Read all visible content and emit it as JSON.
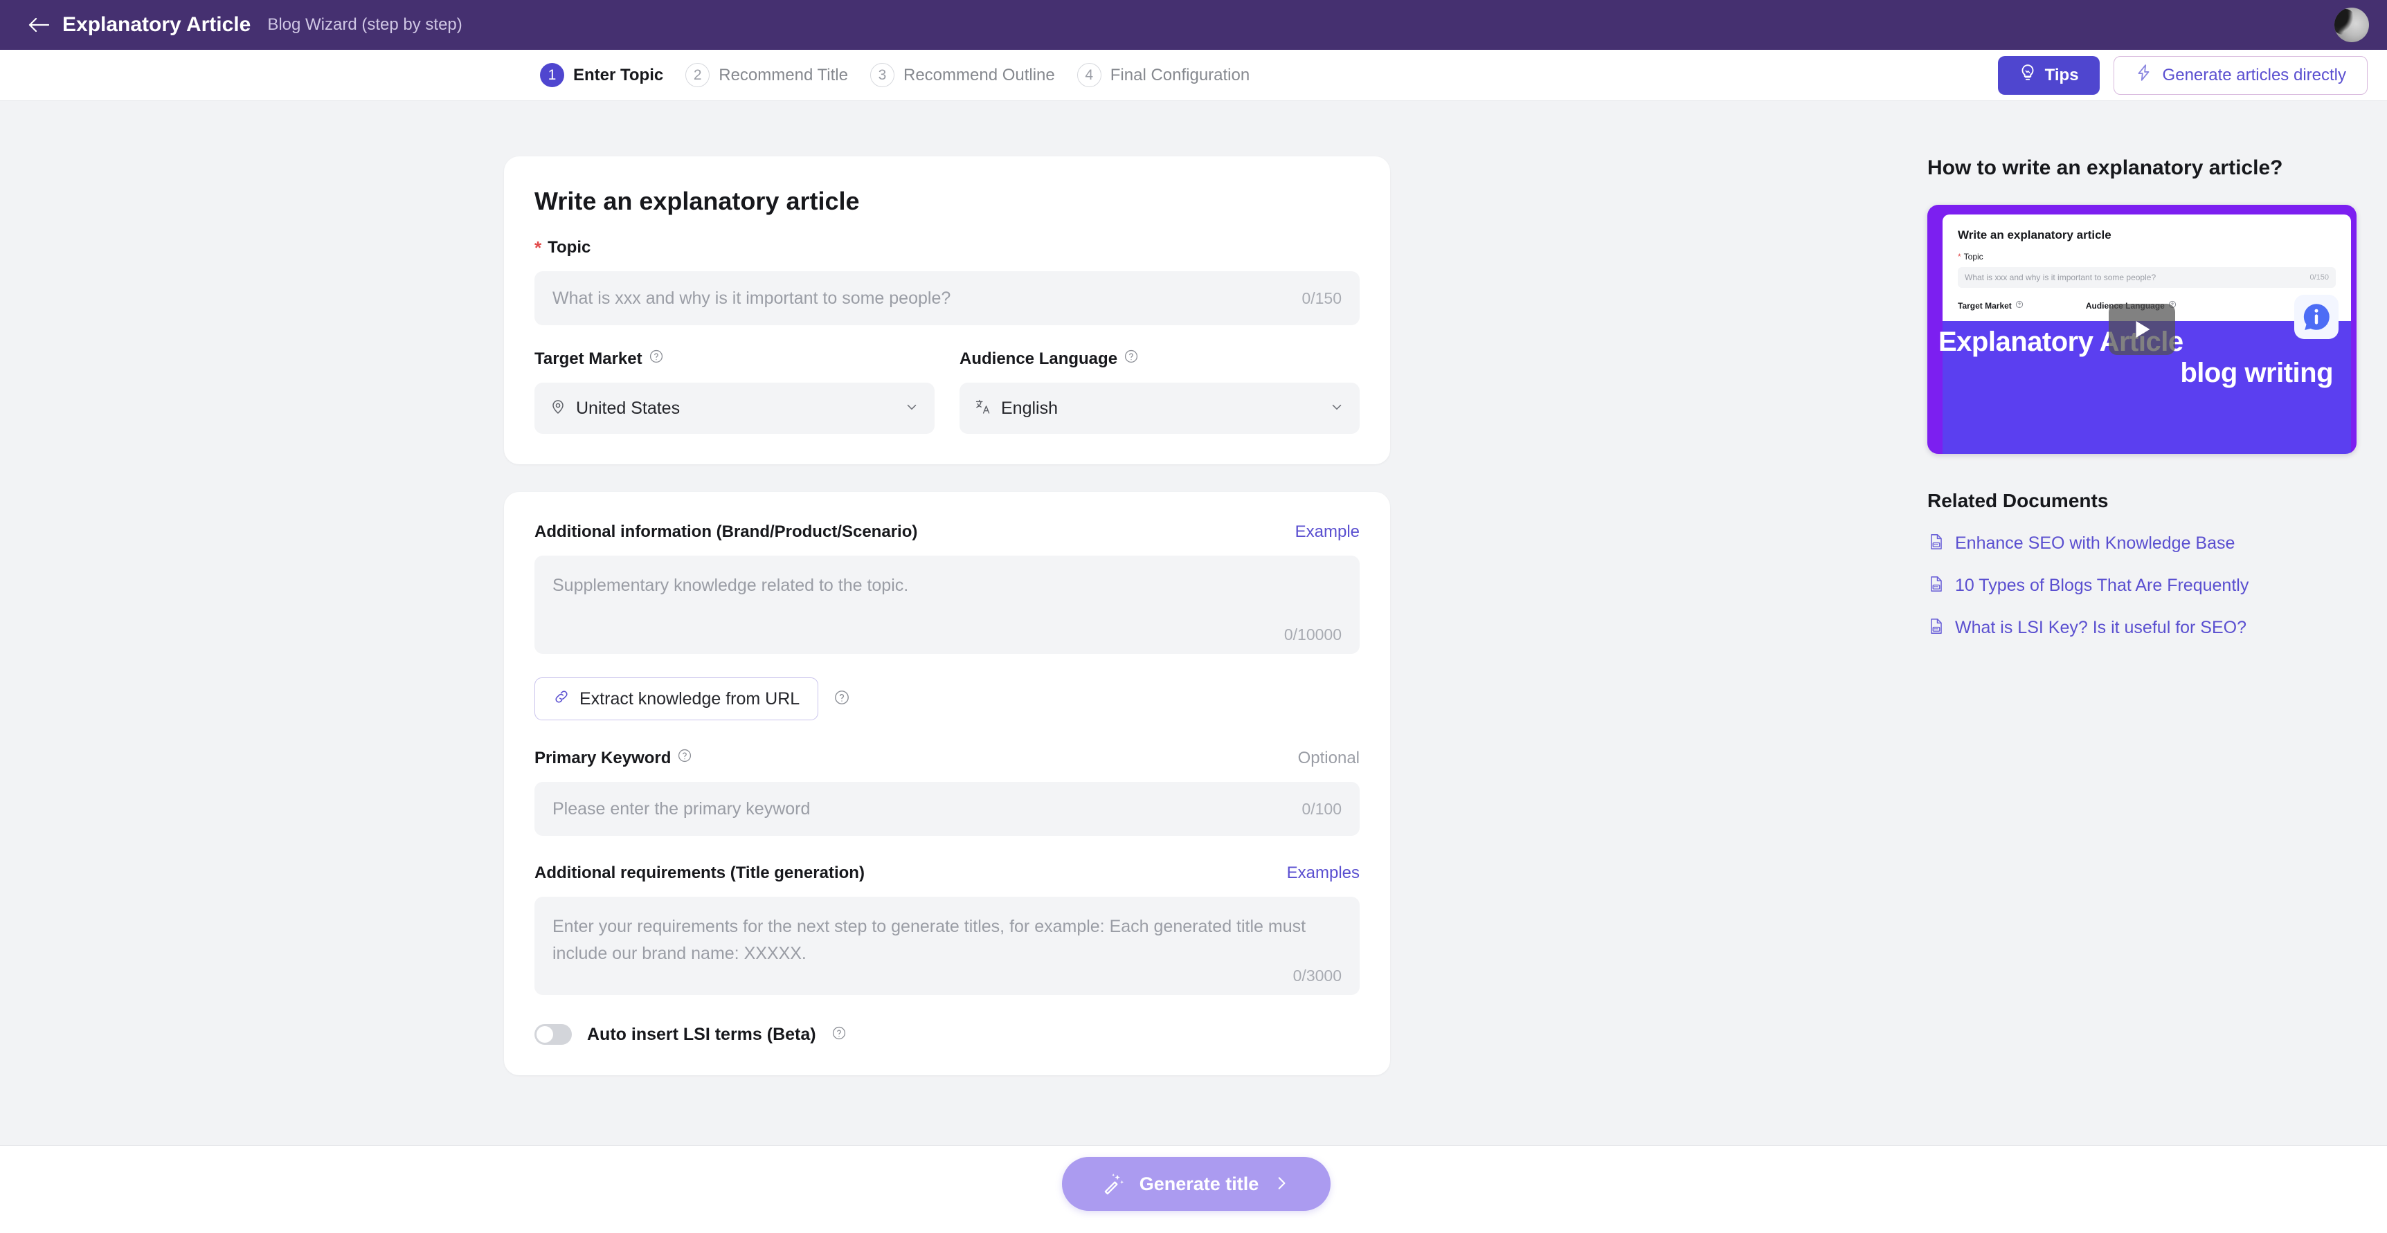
{
  "topbar": {
    "back_icon": "arrow-left-icon",
    "title": "Explanatory Article",
    "subtitle": "Blog Wizard (step by step)",
    "avatar_name": "user-avatar"
  },
  "steps": [
    {
      "num": "1",
      "label": "Enter Topic",
      "active": true
    },
    {
      "num": "2",
      "label": "Recommend Title",
      "active": false
    },
    {
      "num": "3",
      "label": "Recommend Outline",
      "active": false
    },
    {
      "num": "4",
      "label": "Final Configuration",
      "active": false
    }
  ],
  "top_buttons": {
    "tips_label": "Tips",
    "tips_icon": "lightbulb-icon",
    "generate_direct_label": "Generate articles directly",
    "generate_direct_icon": "lightning-bolt-icon"
  },
  "form": {
    "card_title": "Write an explanatory article",
    "topic": {
      "label": "Topic",
      "required_marker": "*",
      "placeholder": "What is xxx and why is it important to some people?",
      "value": "",
      "counter": "0/150"
    },
    "target_market": {
      "label": "Target Market",
      "help_icon": "question-circle-icon",
      "value": "United States",
      "value_icon": "location-pin-icon",
      "chevron": "chevron-down-icon"
    },
    "audience_language": {
      "label": "Audience Language",
      "help_icon": "question-circle-icon",
      "value": "English",
      "value_icon": "translate-icon",
      "chevron": "chevron-down-icon"
    },
    "additional_info": {
      "label": "Additional information (Brand/Product/Scenario)",
      "action_label": "Example",
      "placeholder": "Supplementary knowledge related to the topic.",
      "value": "",
      "counter": "0/10000"
    },
    "extract_url": {
      "label": "Extract knowledge from URL",
      "icon": "link-icon",
      "help_icon": "question-circle-icon"
    },
    "primary_keyword": {
      "label": "Primary Keyword",
      "help_icon": "question-circle-icon",
      "optional_tag": "Optional",
      "placeholder": "Please enter the primary keyword",
      "value": "",
      "counter": "0/100"
    },
    "additional_requirements": {
      "label": "Additional requirements (Title generation)",
      "action_label": "Examples",
      "placeholder": "Enter your requirements for the next step to generate titles, for example: Each generated title must include our brand name: XXXXX.",
      "value": "",
      "counter": "0/3000"
    },
    "lsi_toggle": {
      "label": "Auto insert LSI terms (Beta)",
      "help_icon": "question-circle-icon",
      "enabled": false
    }
  },
  "sidebar": {
    "title": "How to write an explanatory article?",
    "video": {
      "overlay_line1": "Explanatory Article",
      "overlay_line2": "blog writing",
      "play_icon": "play-icon",
      "info_icon": "info-bubble-icon",
      "preview": {
        "title": "Write an explanatory article",
        "topic_label": "Topic",
        "topic_placeholder": "What is xxx and why is it important to some people?",
        "topic_counter": "0/150",
        "target_market_label": "Target Market",
        "audience_language_label": "Audience Language"
      }
    },
    "related_title": "Related Documents",
    "related_docs": [
      {
        "icon": "doc-icon",
        "label": "Enhance SEO with Knowledge Base"
      },
      {
        "icon": "doc-icon",
        "label": "10 Types of Blogs That Are Frequently"
      },
      {
        "icon": "doc-icon",
        "label": "What is LSI Key? Is it useful for SEO?"
      }
    ]
  },
  "footer": {
    "generate_label": "Generate title",
    "wand_icon": "magic-wand-icon",
    "chevron_icon": "chevron-right-icon"
  },
  "colors": {
    "header_purple": "#453070",
    "accent_purple": "#4f46cf",
    "link_purple": "#5a4fd0",
    "page_bg": "#f2f3f5",
    "input_bg": "#f3f4f6",
    "required_red": "#e24a4a",
    "disabled_button": "#ab9bf0",
    "video_purple": "#5b3ff0"
  }
}
